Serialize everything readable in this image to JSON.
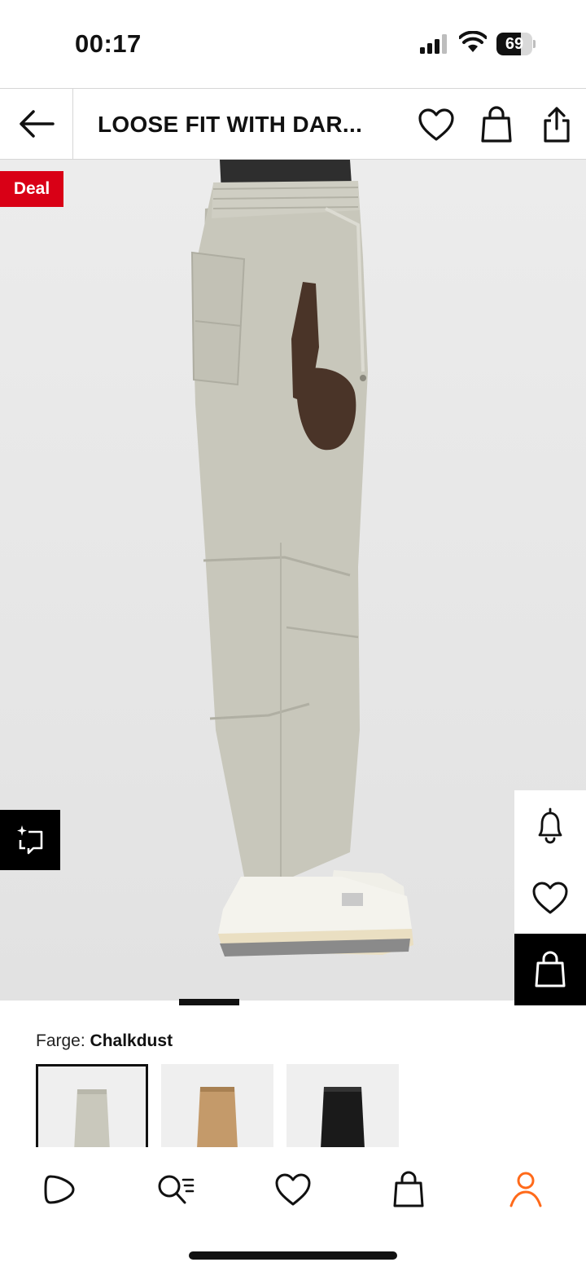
{
  "status_bar": {
    "time": "00:17",
    "battery_level": "69",
    "battery_fraction": 0.69
  },
  "header": {
    "title": "LOOSE FIT WITH DAR...",
    "back_icon": "arrow-left-icon",
    "wishlist_icon": "heart-icon",
    "bag_icon": "shopping-bag-icon",
    "share_icon": "share-icon"
  },
  "product_image": {
    "deal_badge": "Deal",
    "deal_color": "#d90016",
    "background_color": "#e8e8e8",
    "side_actions": [
      "bell-icon",
      "heart-icon",
      "shopping-bag-icon"
    ]
  },
  "color_selector": {
    "label": "Farge:",
    "selected": "Chalkdust",
    "swatches": [
      {
        "name": "swatch-chalkdust",
        "color": "#c9c8bc"
      },
      {
        "name": "swatch-beige",
        "color": "#c49a6a"
      },
      {
        "name": "swatch-black",
        "color": "#1a1a1a"
      }
    ]
  },
  "bottom_nav": {
    "items": [
      "play-icon",
      "search-icon",
      "heart-icon",
      "shopping-bag-icon",
      "profile-icon"
    ],
    "active": "profile-icon",
    "accent_color": "#ff6a1a"
  }
}
